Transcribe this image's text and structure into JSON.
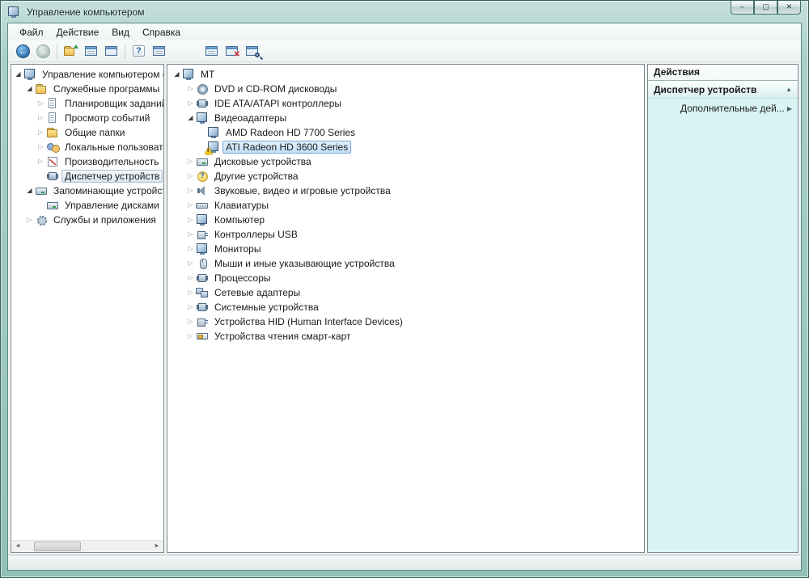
{
  "window": {
    "title": "Управление компьютером",
    "controls": {
      "minimize": "–",
      "maximize": "▢",
      "close": "✕"
    }
  },
  "menu": {
    "items": [
      {
        "label": "Файл"
      },
      {
        "label": "Действие"
      },
      {
        "label": "Вид"
      },
      {
        "label": "Справка"
      }
    ]
  },
  "toolbar": {
    "buttons": [
      "back",
      "forward",
      "up-one-level",
      "show-console-tree",
      "export-list",
      "help",
      "properties",
      "update-driver",
      "uninstall",
      "scan-hardware-changes"
    ],
    "back_glyph": "←",
    "forward_glyph": "→"
  },
  "left_tree": {
    "items": [
      {
        "label": "Управление компьютером (л",
        "level": 0,
        "expander": "expanded",
        "icon": "computer"
      },
      {
        "label": "Служебные программы",
        "level": 1,
        "expander": "expanded",
        "icon": "system-tools"
      },
      {
        "label": "Планировщик заданий",
        "level": 2,
        "expander": "collapsed",
        "icon": "task-scheduler"
      },
      {
        "label": "Просмотр событий",
        "level": 2,
        "expander": "collapsed",
        "icon": "event-viewer"
      },
      {
        "label": "Общие папки",
        "level": 2,
        "expander": "collapsed",
        "icon": "shared-folders"
      },
      {
        "label": "Локальные пользовате",
        "level": 2,
        "expander": "collapsed",
        "icon": "local-users"
      },
      {
        "label": "Производительность",
        "level": 2,
        "expander": "collapsed",
        "icon": "performance"
      },
      {
        "label": "Диспетчер устройств",
        "level": 2,
        "expander": "none",
        "icon": "device-manager",
        "selected": true
      },
      {
        "label": "Запоминающие устройст",
        "level": 1,
        "expander": "expanded",
        "icon": "storage"
      },
      {
        "label": "Управление дисками",
        "level": 2,
        "expander": "none",
        "icon": "disk-management"
      },
      {
        "label": "Службы и приложения",
        "level": 1,
        "expander": "collapsed",
        "icon": "services"
      }
    ]
  },
  "device_tree": {
    "items": [
      {
        "label": "MT",
        "level": 0,
        "expander": "expanded",
        "icon": "computer"
      },
      {
        "label": "DVD и CD-ROM дисководы",
        "level": 1,
        "expander": "collapsed",
        "icon": "dvd-drive"
      },
      {
        "label": "IDE ATA/ATAPI контроллеры",
        "level": 1,
        "expander": "collapsed",
        "icon": "ide-controller"
      },
      {
        "label": "Видеоадаптеры",
        "level": 1,
        "expander": "expanded",
        "icon": "display-adapter"
      },
      {
        "label": "AMD Radeon HD 7700 Series",
        "level": 2,
        "expander": "none",
        "icon": "display-adapter"
      },
      {
        "label": "ATI Radeon HD 3600 Series",
        "level": 2,
        "expander": "none",
        "icon": "display-adapter",
        "warning": true,
        "selected": true
      },
      {
        "label": "Дисковые устройства",
        "level": 1,
        "expander": "collapsed",
        "icon": "disk-drive"
      },
      {
        "label": "Другие устройства",
        "level": 1,
        "expander": "collapsed",
        "icon": "unknown-device"
      },
      {
        "label": "Звуковые, видео и игровые устройства",
        "level": 1,
        "expander": "collapsed",
        "icon": "audio-device"
      },
      {
        "label": "Клавиатуры",
        "level": 1,
        "expander": "collapsed",
        "icon": "keyboard"
      },
      {
        "label": "Компьютер",
        "level": 1,
        "expander": "collapsed",
        "icon": "computer"
      },
      {
        "label": "Контроллеры USB",
        "level": 1,
        "expander": "collapsed",
        "icon": "usb-controller"
      },
      {
        "label": "Мониторы",
        "level": 1,
        "expander": "collapsed",
        "icon": "monitor"
      },
      {
        "label": "Мыши и иные указывающие устройства",
        "level": 1,
        "expander": "collapsed",
        "icon": "mouse"
      },
      {
        "label": "Процессоры",
        "level": 1,
        "expander": "collapsed",
        "icon": "processor"
      },
      {
        "label": "Сетевые адаптеры",
        "level": 1,
        "expander": "collapsed",
        "icon": "network-adapter"
      },
      {
        "label": "Системные устройства",
        "level": 1,
        "expander": "collapsed",
        "icon": "system-device"
      },
      {
        "label": "Устройства HID (Human Interface Devices)",
        "level": 1,
        "expander": "collapsed",
        "icon": "hid-device"
      },
      {
        "label": "Устройства чтения смарт-карт",
        "level": 1,
        "expander": "collapsed",
        "icon": "smartcard-reader"
      }
    ]
  },
  "actions_pane": {
    "title": "Действия",
    "section": "Диспетчер устройств",
    "collapse_icon": "▲",
    "items": [
      {
        "label": "Дополнительные дей...",
        "submenu_icon": "▶"
      }
    ]
  },
  "status_bar": {
    "text": ""
  }
}
